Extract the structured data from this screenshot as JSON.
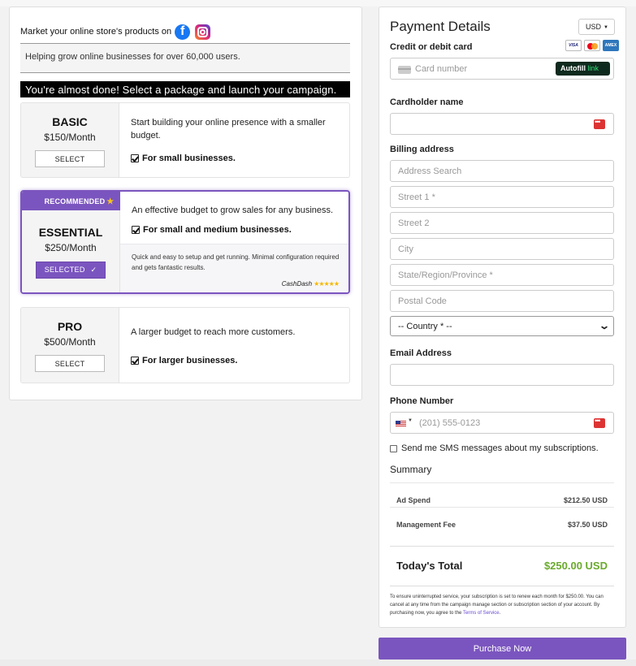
{
  "header": {
    "market_text": "Market your online store's products on",
    "helping_text": "Helping grow online businesses for over 60,000 users.",
    "almost_done": "You're almost done! Select a package and launch your campaign."
  },
  "packages": [
    {
      "name": "BASIC",
      "price": "$150/Month",
      "button": "SELECT",
      "description": "Start building your online presence with a smaller budget.",
      "feature": "For small businesses."
    },
    {
      "badge": "RECOMMENDED",
      "badge_icon": "star-icon",
      "name": "ESSENTIAL",
      "price": "$250/Month",
      "button": "SELECTED",
      "button_check": "✓",
      "description": "An effective budget to grow sales for any business.",
      "feature": "For small and medium businesses.",
      "quote": "Quick and easy to setup and get running. Minimal configuration required and gets fantastic results.",
      "quote_by": "CashDash",
      "rating_stars": 5
    },
    {
      "name": "PRO",
      "price": "$500/Month",
      "button": "SELECT",
      "description": "A larger budget to reach more customers.",
      "feature": "For larger businesses."
    }
  ],
  "payment": {
    "title": "Payment Details",
    "currency": "USD",
    "card_label": "Credit or debit card",
    "card_placeholder": "Card number",
    "autofill": "Autofill",
    "autofill_link": "link",
    "card_brands": [
      "visa",
      "mastercard",
      "amex"
    ],
    "cardholder_label": "Cardholder name",
    "billing_label": "Billing address",
    "address_search": "Address Search",
    "street1": "Street 1 *",
    "street2": "Street 2",
    "city": "City",
    "state": "State/Region/Province *",
    "postal": "Postal Code",
    "country": "-- Country * --",
    "email_label": "Email Address",
    "phone_label": "Phone Number",
    "phone_placeholder": "(201) 555-0123",
    "sms_text": "Send me SMS messages about my subscriptions."
  },
  "summary": {
    "title": "Summary",
    "rows": [
      {
        "label": "Ad Spend",
        "value": "$212.50 USD"
      },
      {
        "label": "Management Fee",
        "value": "$37.50 USD"
      }
    ],
    "total_label": "Today's Total",
    "total_value": "$250.00 USD",
    "fine_print": "To ensure uninterrupted service, your subscription is set to renew each month for $250.00. You can cancel at any time from the campaign manage section or subscription section of your account. By purchasing now, you agree to the",
    "terms_link": "Terms of Service",
    "terms_end": "."
  },
  "purchase_button": "Purchase Now",
  "colors": {
    "accent": "#7b55bf",
    "total_green": "#6aaa2c",
    "facebook": "#1877f2"
  }
}
